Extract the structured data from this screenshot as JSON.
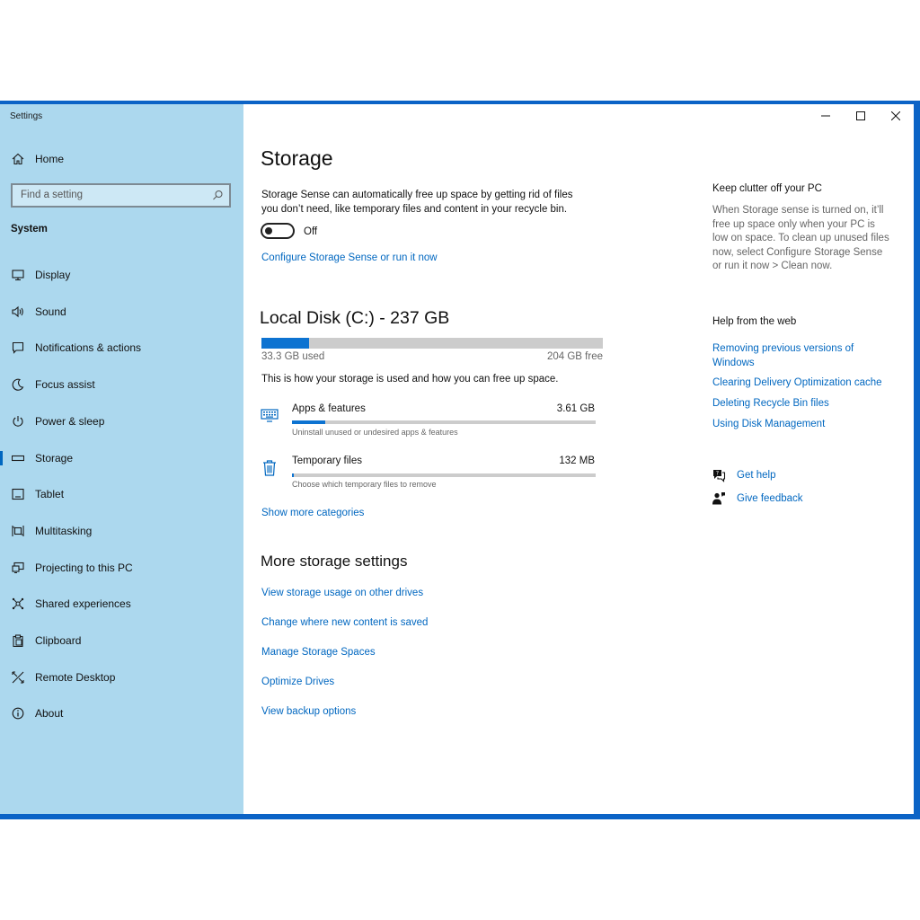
{
  "app": {
    "title": "Settings"
  },
  "sidebar": {
    "home_label": "Home",
    "search_placeholder": "Find a setting",
    "section_title": "System",
    "items": [
      {
        "label": "Display",
        "icon": "monitor-icon"
      },
      {
        "label": "Sound",
        "icon": "speaker-icon"
      },
      {
        "label": "Notifications & actions",
        "icon": "notification-icon"
      },
      {
        "label": "Focus assist",
        "icon": "moon-icon"
      },
      {
        "label": "Power & sleep",
        "icon": "power-icon"
      },
      {
        "label": "Storage",
        "icon": "storage-icon",
        "active": true
      },
      {
        "label": "Tablet",
        "icon": "tablet-icon"
      },
      {
        "label": "Multitasking",
        "icon": "multitasking-icon"
      },
      {
        "label": "Projecting to this PC",
        "icon": "projector-icon"
      },
      {
        "label": "Shared experiences",
        "icon": "shared-icon"
      },
      {
        "label": "Clipboard",
        "icon": "clipboard-icon"
      },
      {
        "label": "Remote Desktop",
        "icon": "remote-desktop-icon"
      },
      {
        "label": "About",
        "icon": "info-icon"
      }
    ]
  },
  "main": {
    "title": "Storage",
    "storage_sense": {
      "description_line1": "Storage Sense can automatically free up space by getting rid of files",
      "description_line2": "you don’t need, like temporary files and content in your recycle bin.",
      "toggle_state": "Off",
      "configure_link": "Configure Storage Sense or run it now"
    },
    "disk": {
      "title": "Local Disk (C:) - 237 GB",
      "used_label": "33.3 GB used",
      "free_label": "204 GB free",
      "used_fraction": 0.14,
      "description": "This is how your storage is used and how you can free up space."
    },
    "categories": [
      {
        "name": "Apps & features",
        "size": "3.61 GB",
        "sub": "Uninstall unused or undesired apps & features",
        "fraction": 0.11,
        "icon": "keyboard-icon"
      },
      {
        "name": "Temporary files",
        "size": "132 MB",
        "sub": "Choose which temporary files to remove",
        "fraction": 0.005,
        "icon": "trash-icon"
      }
    ],
    "show_more_link": "Show more categories",
    "more_settings": {
      "title": "More storage settings",
      "links": [
        "View storage usage on other drives",
        "Change where new content is saved",
        "Manage Storage Spaces",
        "Optimize Drives",
        "View backup options"
      ]
    }
  },
  "right": {
    "tip_title": "Keep clutter off your PC",
    "tip_lines": [
      "When Storage sense is turned on, it’ll",
      "free up space only when your PC is",
      "low on space. To clean up unused files",
      "now, select Configure Storage Sense",
      "or run it now > Clean now."
    ],
    "help_title": "Help from the web",
    "help_links": [
      {
        "line1": "Removing previous versions of",
        "line2": "Windows"
      },
      {
        "line1": "Clearing Delivery Optimization cache"
      },
      {
        "line1": "Deleting Recycle Bin files"
      },
      {
        "line1": "Using Disk Management"
      }
    ],
    "get_help": "Get help",
    "give_feedback": "Give feedback"
  },
  "colors": {
    "accent": "#0067c0",
    "sidebar_bg": "#acd8ee",
    "bar_fill": "#0d73d1",
    "bar_track": "#cccccc"
  }
}
